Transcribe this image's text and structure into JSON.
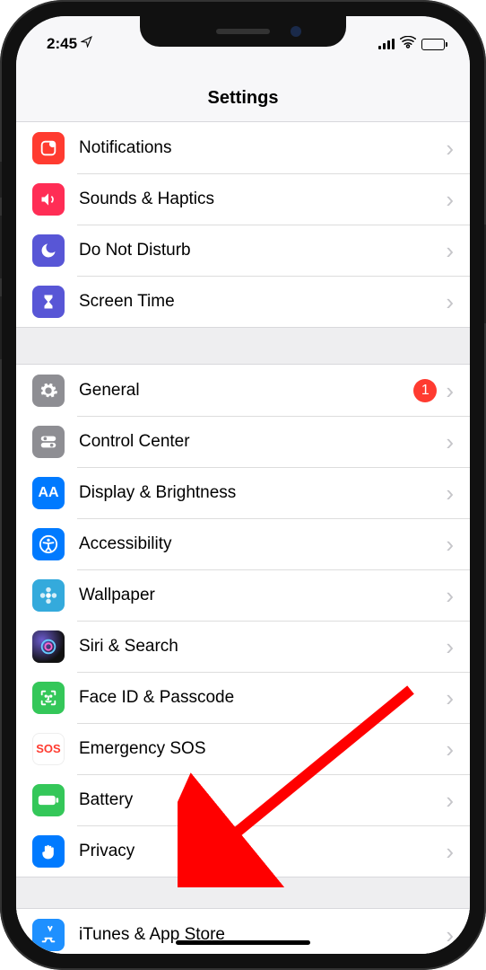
{
  "status": {
    "time": "2:45",
    "location_icon": "location-arrow-icon",
    "cell_bars": 4,
    "wifi": true,
    "battery_level_pct": 18,
    "battery_color": "#f39c12"
  },
  "header": {
    "title": "Settings"
  },
  "sections": [
    {
      "items": [
        {
          "id": "notifications",
          "label": "Notifications",
          "icon": "notifications-icon",
          "icon_bg": "#ff3b30"
        },
        {
          "id": "sounds",
          "label": "Sounds & Haptics",
          "icon": "speaker-icon",
          "icon_bg": "#ff2d55"
        },
        {
          "id": "dnd",
          "label": "Do Not Disturb",
          "icon": "moon-icon",
          "icon_bg": "#5856d6"
        },
        {
          "id": "screentime",
          "label": "Screen Time",
          "icon": "hourglass-icon",
          "icon_bg": "#5856d6"
        }
      ]
    },
    {
      "items": [
        {
          "id": "general",
          "label": "General",
          "icon": "gear-icon",
          "icon_bg": "#8e8e93",
          "badge": "1"
        },
        {
          "id": "controlcenter",
          "label": "Control Center",
          "icon": "toggles-icon",
          "icon_bg": "#8e8e93"
        },
        {
          "id": "display",
          "label": "Display & Brightness",
          "icon": "textsize-icon",
          "icon_bg": "#007aff"
        },
        {
          "id": "accessibility",
          "label": "Accessibility",
          "icon": "accessibility-icon",
          "icon_bg": "#007aff"
        },
        {
          "id": "wallpaper",
          "label": "Wallpaper",
          "icon": "flower-icon",
          "icon_bg": "#34aadc"
        },
        {
          "id": "siri",
          "label": "Siri & Search",
          "icon": "siri-icon",
          "icon_bg": "#222"
        },
        {
          "id": "faceid",
          "label": "Face ID & Passcode",
          "icon": "faceid-icon",
          "icon_bg": "#34c759"
        },
        {
          "id": "sos",
          "label": "Emergency SOS",
          "icon": "sos-icon",
          "icon_bg": "#ffffff",
          "icon_text": "SOS"
        },
        {
          "id": "battery",
          "label": "Battery",
          "icon": "battery-icon",
          "icon_bg": "#34c759"
        },
        {
          "id": "privacy",
          "label": "Privacy",
          "icon": "hand-icon",
          "icon_bg": "#007aff"
        }
      ]
    },
    {
      "items": [
        {
          "id": "itunes",
          "label": "iTunes & App Store",
          "icon": "appstore-icon",
          "icon_bg": "#1e90ff"
        }
      ]
    }
  ],
  "annotation": {
    "arrow_target": "privacy",
    "arrow_color": "#ff0000"
  }
}
